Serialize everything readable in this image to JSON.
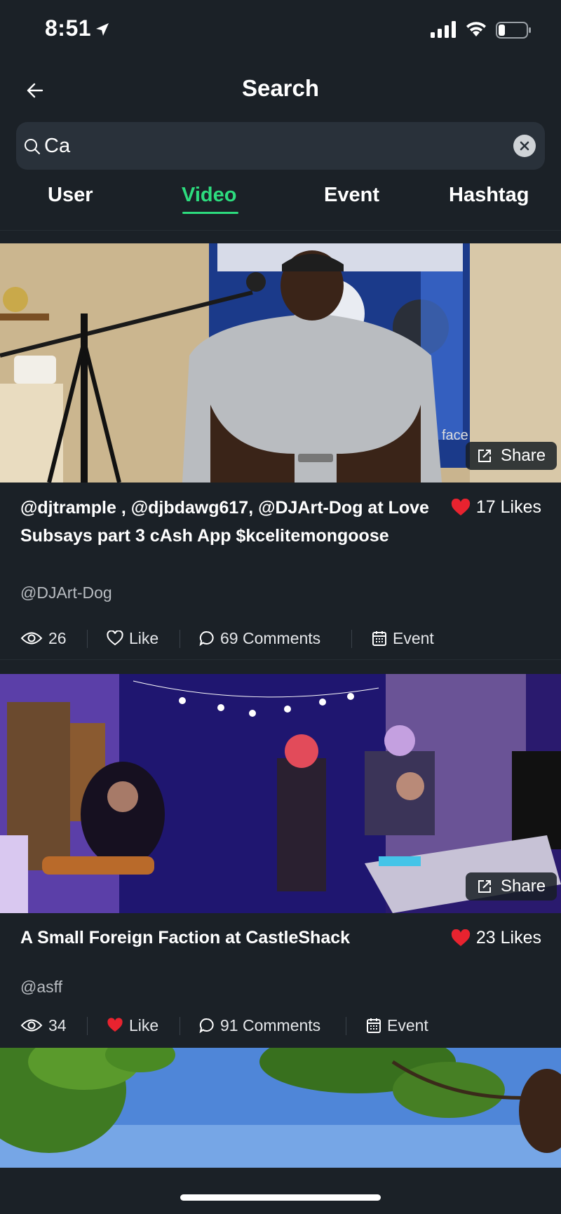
{
  "status_bar": {
    "time": "8:51"
  },
  "header": {
    "title": "Search"
  },
  "search": {
    "value": "Ca",
    "placeholder": ""
  },
  "tabs": [
    {
      "label": "User",
      "active": false
    },
    {
      "label": "Video",
      "active": true
    },
    {
      "label": "Event",
      "active": false
    },
    {
      "label": "Hashtag",
      "active": false
    }
  ],
  "videos": [
    {
      "title": "@djtrample , @djbdawg617, @DJArt-Dog at Love Subsays part 3 cAsh App $kcelitemongoose",
      "author": "@DJArt-Dog",
      "likes": "17 Likes",
      "views": "26",
      "like_label": "Like",
      "liked": false,
      "comments": "69 Comments",
      "event_label": "Event",
      "share_label": "Share"
    },
    {
      "title": "A Small Foreign Faction at CastleShack",
      "author": "@asff",
      "likes": "23 Likes",
      "views": "34",
      "like_label": "Like",
      "liked": true,
      "comments": "91 Comments",
      "event_label": "Event",
      "share_label": "Share"
    }
  ],
  "colors": {
    "accent": "#2ddc7e",
    "background": "#1b2127",
    "heart": "#e8232f"
  }
}
